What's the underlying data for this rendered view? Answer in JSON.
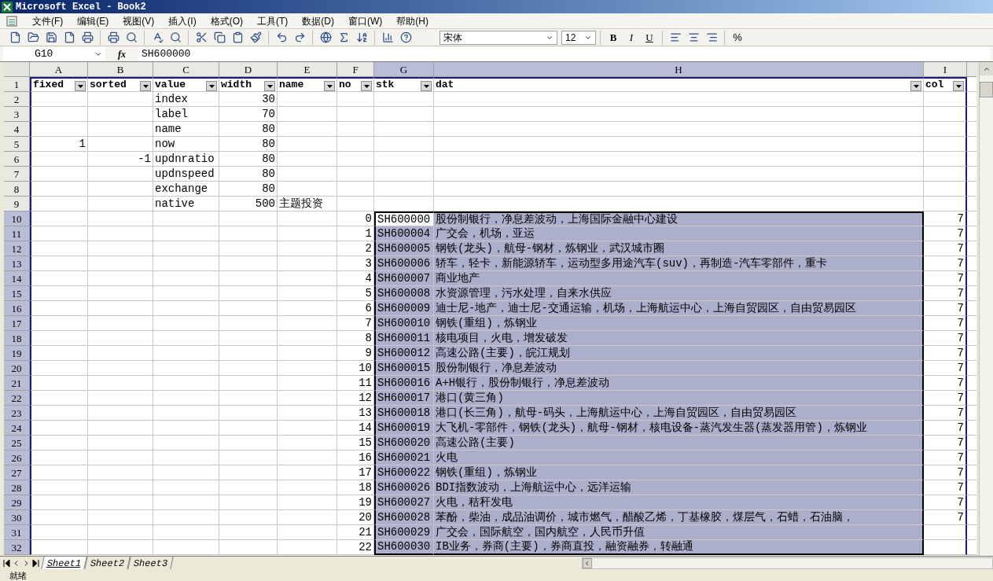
{
  "title": "Microsoft Excel - Book2",
  "menu": [
    "文件(F)",
    "编辑(E)",
    "视图(V)",
    "插入(I)",
    "格式(O)",
    "工具(T)",
    "数据(D)",
    "窗口(W)",
    "帮助(H)"
  ],
  "toolbar": {
    "font": "宋体",
    "size": "12",
    "bold": "B",
    "italic": "I",
    "underline": "U",
    "percent": "%"
  },
  "formula_bar": {
    "name_box": "G10",
    "function_label": "fx",
    "formula": "SH600000"
  },
  "columns": [
    {
      "letter": "A",
      "selected": false,
      "kind": "number"
    },
    {
      "letter": "B",
      "selected": false,
      "kind": "number"
    },
    {
      "letter": "C",
      "selected": false,
      "kind": "text"
    },
    {
      "letter": "D",
      "selected": false,
      "kind": "number"
    },
    {
      "letter": "E",
      "selected": false,
      "kind": "text"
    },
    {
      "letter": "F",
      "selected": false,
      "kind": "number"
    },
    {
      "letter": "G",
      "selected": true,
      "kind": "text"
    },
    {
      "letter": "H",
      "selected": true,
      "kind": "text"
    },
    {
      "letter": "I",
      "selected": false,
      "kind": "number"
    }
  ],
  "rows": [
    {
      "number": "1",
      "kind": "filter",
      "selected": false,
      "cells": {
        "A": "fixed",
        "B": "sorted",
        "C": "value",
        "D": "width",
        "E": "name",
        "F": "no",
        "G": "stk",
        "H": "dat",
        "I": "col"
      }
    },
    {
      "number": "2",
      "kind": "data",
      "selected": false,
      "cells": {
        "C": "index",
        "D": "30"
      }
    },
    {
      "number": "3",
      "kind": "data",
      "selected": false,
      "cells": {
        "C": "label",
        "D": "70"
      }
    },
    {
      "number": "4",
      "kind": "data",
      "selected": false,
      "cells": {
        "C": "name",
        "D": "80"
      }
    },
    {
      "number": "5",
      "kind": "data",
      "selected": false,
      "cells": {
        "A": "1",
        "C": "now",
        "D": "80"
      }
    },
    {
      "number": "6",
      "kind": "data",
      "selected": false,
      "cells": {
        "B": "-1",
        "C": "updnratio",
        "D": "80"
      }
    },
    {
      "number": "7",
      "kind": "data",
      "selected": false,
      "cells": {
        "C": "updnspeed",
        "D": "80"
      }
    },
    {
      "number": "8",
      "kind": "data",
      "selected": false,
      "cells": {
        "C": "exchange",
        "D": "80"
      }
    },
    {
      "number": "9",
      "kind": "data",
      "selected": false,
      "cells": {
        "C": "native",
        "D": "500",
        "E": "主题投资"
      }
    },
    {
      "number": "10",
      "kind": "data",
      "selected": true,
      "cells": {
        "F": "0",
        "G": "SH600000",
        "H": "股份制银行，净息差波动，上海国际金融中心建设",
        "I": "7"
      }
    },
    {
      "number": "11",
      "kind": "data",
      "selected": true,
      "cells": {
        "F": "1",
        "G": "SH600004",
        "H": "广交会，机场，亚运",
        "I": "7"
      }
    },
    {
      "number": "12",
      "kind": "data",
      "selected": true,
      "cells": {
        "F": "2",
        "G": "SH600005",
        "H": "钢铁(龙头)，航母-钢材，炼钢业，武汉城市圈",
        "I": "7"
      }
    },
    {
      "number": "13",
      "kind": "data",
      "selected": true,
      "cells": {
        "F": "3",
        "G": "SH600006",
        "H": "轿车，轻卡，新能源轿车，运动型多用途汽车(suv)，再制造-汽车零部件，重卡",
        "I": "7"
      }
    },
    {
      "number": "14",
      "kind": "data",
      "selected": true,
      "cells": {
        "F": "4",
        "G": "SH600007",
        "H": "商业地产",
        "I": "7"
      }
    },
    {
      "number": "15",
      "kind": "data",
      "selected": true,
      "cells": {
        "F": "5",
        "G": "SH600008",
        "H": "水资源管理，污水处理，自来水供应",
        "I": "7"
      }
    },
    {
      "number": "16",
      "kind": "data",
      "selected": true,
      "cells": {
        "F": "6",
        "G": "SH600009",
        "H": "迪士尼-地产，迪士尼-交通运输，机场，上海航运中心，上海自贸园区，自由贸易园区",
        "I": "7"
      }
    },
    {
      "number": "17",
      "kind": "data",
      "selected": true,
      "cells": {
        "F": "7",
        "G": "SH600010",
        "H": "钢铁(重组)，炼钢业",
        "I": "7"
      }
    },
    {
      "number": "18",
      "kind": "data",
      "selected": true,
      "cells": {
        "F": "8",
        "G": "SH600011",
        "H": "核电项目，火电，增发破发",
        "I": "7"
      }
    },
    {
      "number": "19",
      "kind": "data",
      "selected": true,
      "cells": {
        "F": "9",
        "G": "SH600012",
        "H": "高速公路(主要)，皖江规划",
        "I": "7"
      }
    },
    {
      "number": "20",
      "kind": "data",
      "selected": true,
      "cells": {
        "F": "10",
        "G": "SH600015",
        "H": "股份制银行，净息差波动",
        "I": "7"
      }
    },
    {
      "number": "21",
      "kind": "data",
      "selected": true,
      "cells": {
        "F": "11",
        "G": "SH600016",
        "H": "A+H银行，股份制银行，净息差波动",
        "I": "7"
      }
    },
    {
      "number": "22",
      "kind": "data",
      "selected": true,
      "cells": {
        "F": "12",
        "G": "SH600017",
        "H": "港口(黄三角)",
        "I": "7"
      }
    },
    {
      "number": "23",
      "kind": "data",
      "selected": true,
      "cells": {
        "F": "13",
        "G": "SH600018",
        "H": "港口(长三角)，航母-码头，上海航运中心，上海自贸园区，自由贸易园区",
        "I": "7"
      }
    },
    {
      "number": "24",
      "kind": "data",
      "selected": true,
      "cells": {
        "F": "14",
        "G": "SH600019",
        "H": "大飞机-零部件，钢铁(龙头)，航母-钢材，核电设备-蒸汽发生器(蒸发器用管)，炼钢业",
        "I": "7"
      }
    },
    {
      "number": "25",
      "kind": "data",
      "selected": true,
      "cells": {
        "F": "15",
        "G": "SH600020",
        "H": "高速公路(主要)",
        "I": "7"
      }
    },
    {
      "number": "26",
      "kind": "data",
      "selected": true,
      "cells": {
        "F": "16",
        "G": "SH600021",
        "H": "火电",
        "I": "7"
      }
    },
    {
      "number": "27",
      "kind": "data",
      "selected": true,
      "cells": {
        "F": "17",
        "G": "SH600022",
        "H": "钢铁(重组)，炼钢业",
        "I": "7"
      }
    },
    {
      "number": "28",
      "kind": "data",
      "selected": true,
      "cells": {
        "F": "18",
        "G": "SH600026",
        "H": "BDI指数波动，上海航运中心，远洋运输",
        "I": "7"
      }
    },
    {
      "number": "29",
      "kind": "data",
      "selected": true,
      "cells": {
        "F": "19",
        "G": "SH600027",
        "H": "火电，秸秆发电",
        "I": "7"
      }
    },
    {
      "number": "30",
      "kind": "data",
      "selected": true,
      "cells": {
        "F": "20",
        "G": "SH600028",
        "H": "苯酚，柴油，成品油调价，城市燃气，醋酸乙烯，丁基橡胶，煤层气，石蜡，石油脑，",
        "I": "7"
      }
    },
    {
      "number": "31",
      "kind": "data",
      "selected": true,
      "cells": {
        "F": "21",
        "G": "SH600029",
        "H": "广交会，国际航空，国内航空，人民币升值"
      }
    },
    {
      "number": "32",
      "kind": "data",
      "selected": true,
      "cells": {
        "F": "22",
        "G": "SH600030",
        "H": "IB业务，券商(主要)，券商直投，融资融券，转融通"
      }
    }
  ],
  "sheet_tabs": [
    {
      "label": "Sheet1",
      "selected": true
    },
    {
      "label": "Sheet2",
      "selected": false
    },
    {
      "label": "Sheet3",
      "selected": false
    }
  ],
  "status_bar": "就绪"
}
